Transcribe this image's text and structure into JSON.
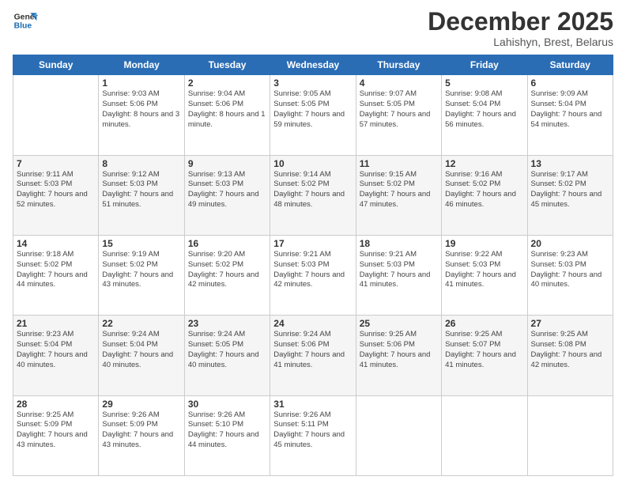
{
  "logo": {
    "line1": "General",
    "line2": "Blue"
  },
  "header": {
    "month": "December 2025",
    "location": "Lahishyn, Brest, Belarus"
  },
  "weekdays": [
    "Sunday",
    "Monday",
    "Tuesday",
    "Wednesday",
    "Thursday",
    "Friday",
    "Saturday"
  ],
  "weeks": [
    [
      {
        "day": "",
        "info": ""
      },
      {
        "day": "1",
        "info": "Sunrise: 9:03 AM\nSunset: 5:06 PM\nDaylight: 8 hours\nand 3 minutes."
      },
      {
        "day": "2",
        "info": "Sunrise: 9:04 AM\nSunset: 5:06 PM\nDaylight: 8 hours\nand 1 minute."
      },
      {
        "day": "3",
        "info": "Sunrise: 9:05 AM\nSunset: 5:05 PM\nDaylight: 7 hours\nand 59 minutes."
      },
      {
        "day": "4",
        "info": "Sunrise: 9:07 AM\nSunset: 5:05 PM\nDaylight: 7 hours\nand 57 minutes."
      },
      {
        "day": "5",
        "info": "Sunrise: 9:08 AM\nSunset: 5:04 PM\nDaylight: 7 hours\nand 56 minutes."
      },
      {
        "day": "6",
        "info": "Sunrise: 9:09 AM\nSunset: 5:04 PM\nDaylight: 7 hours\nand 54 minutes."
      }
    ],
    [
      {
        "day": "7",
        "info": "Sunrise: 9:11 AM\nSunset: 5:03 PM\nDaylight: 7 hours\nand 52 minutes."
      },
      {
        "day": "8",
        "info": "Sunrise: 9:12 AM\nSunset: 5:03 PM\nDaylight: 7 hours\nand 51 minutes."
      },
      {
        "day": "9",
        "info": "Sunrise: 9:13 AM\nSunset: 5:03 PM\nDaylight: 7 hours\nand 49 minutes."
      },
      {
        "day": "10",
        "info": "Sunrise: 9:14 AM\nSunset: 5:02 PM\nDaylight: 7 hours\nand 48 minutes."
      },
      {
        "day": "11",
        "info": "Sunrise: 9:15 AM\nSunset: 5:02 PM\nDaylight: 7 hours\nand 47 minutes."
      },
      {
        "day": "12",
        "info": "Sunrise: 9:16 AM\nSunset: 5:02 PM\nDaylight: 7 hours\nand 46 minutes."
      },
      {
        "day": "13",
        "info": "Sunrise: 9:17 AM\nSunset: 5:02 PM\nDaylight: 7 hours\nand 45 minutes."
      }
    ],
    [
      {
        "day": "14",
        "info": "Sunrise: 9:18 AM\nSunset: 5:02 PM\nDaylight: 7 hours\nand 44 minutes."
      },
      {
        "day": "15",
        "info": "Sunrise: 9:19 AM\nSunset: 5:02 PM\nDaylight: 7 hours\nand 43 minutes."
      },
      {
        "day": "16",
        "info": "Sunrise: 9:20 AM\nSunset: 5:02 PM\nDaylight: 7 hours\nand 42 minutes."
      },
      {
        "day": "17",
        "info": "Sunrise: 9:21 AM\nSunset: 5:03 PM\nDaylight: 7 hours\nand 42 minutes."
      },
      {
        "day": "18",
        "info": "Sunrise: 9:21 AM\nSunset: 5:03 PM\nDaylight: 7 hours\nand 41 minutes."
      },
      {
        "day": "19",
        "info": "Sunrise: 9:22 AM\nSunset: 5:03 PM\nDaylight: 7 hours\nand 41 minutes."
      },
      {
        "day": "20",
        "info": "Sunrise: 9:23 AM\nSunset: 5:03 PM\nDaylight: 7 hours\nand 40 minutes."
      }
    ],
    [
      {
        "day": "21",
        "info": "Sunrise: 9:23 AM\nSunset: 5:04 PM\nDaylight: 7 hours\nand 40 minutes."
      },
      {
        "day": "22",
        "info": "Sunrise: 9:24 AM\nSunset: 5:04 PM\nDaylight: 7 hours\nand 40 minutes."
      },
      {
        "day": "23",
        "info": "Sunrise: 9:24 AM\nSunset: 5:05 PM\nDaylight: 7 hours\nand 40 minutes."
      },
      {
        "day": "24",
        "info": "Sunrise: 9:24 AM\nSunset: 5:06 PM\nDaylight: 7 hours\nand 41 minutes."
      },
      {
        "day": "25",
        "info": "Sunrise: 9:25 AM\nSunset: 5:06 PM\nDaylight: 7 hours\nand 41 minutes."
      },
      {
        "day": "26",
        "info": "Sunrise: 9:25 AM\nSunset: 5:07 PM\nDaylight: 7 hours\nand 41 minutes."
      },
      {
        "day": "27",
        "info": "Sunrise: 9:25 AM\nSunset: 5:08 PM\nDaylight: 7 hours\nand 42 minutes."
      }
    ],
    [
      {
        "day": "28",
        "info": "Sunrise: 9:25 AM\nSunset: 5:09 PM\nDaylight: 7 hours\nand 43 minutes."
      },
      {
        "day": "29",
        "info": "Sunrise: 9:26 AM\nSunset: 5:09 PM\nDaylight: 7 hours\nand 43 minutes."
      },
      {
        "day": "30",
        "info": "Sunrise: 9:26 AM\nSunset: 5:10 PM\nDaylight: 7 hours\nand 44 minutes."
      },
      {
        "day": "31",
        "info": "Sunrise: 9:26 AM\nSunset: 5:11 PM\nDaylight: 7 hours\nand 45 minutes."
      },
      {
        "day": "",
        "info": ""
      },
      {
        "day": "",
        "info": ""
      },
      {
        "day": "",
        "info": ""
      }
    ]
  ]
}
